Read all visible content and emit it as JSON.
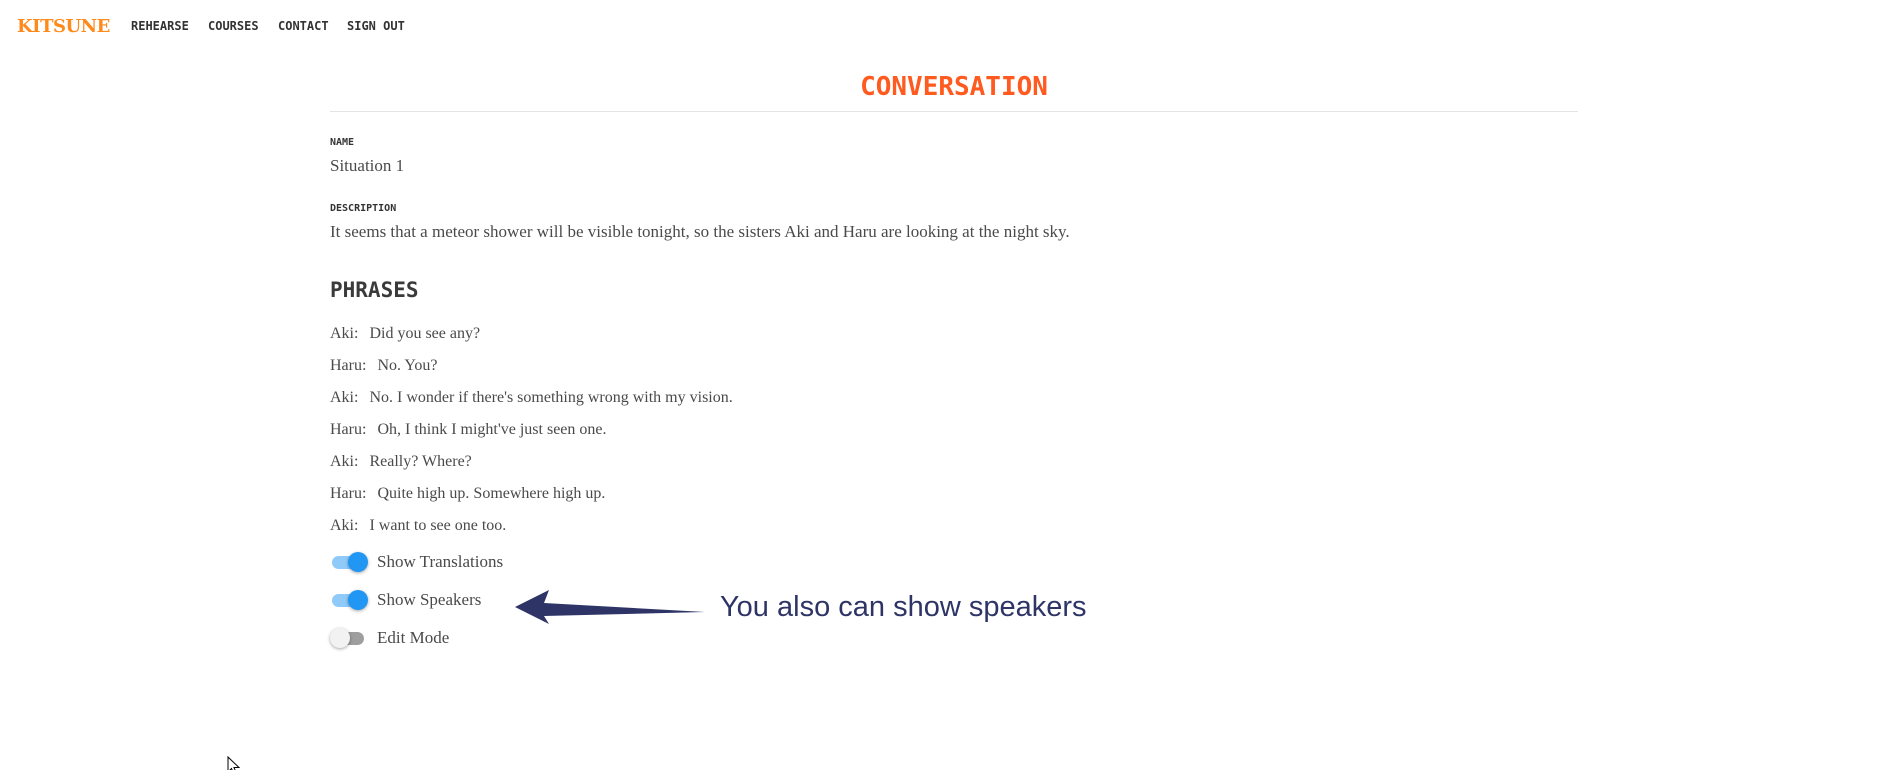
{
  "nav": {
    "logo": "KITSUNE",
    "links": [
      "REHEARSE",
      "COURSES",
      "CONTACT",
      "SIGN OUT"
    ]
  },
  "page": {
    "title": "CONVERSATION",
    "name_label": "NAME",
    "name_value": "Situation 1",
    "description_label": "DESCRIPTION",
    "description_value": "It seems that a meteor shower will be visible tonight, so the sisters Aki and Haru are looking at the night sky.",
    "phrases_heading": "PHRASES"
  },
  "phrases": [
    {
      "speaker": "Aki:",
      "text": "Did you see any?"
    },
    {
      "speaker": "Haru:",
      "text": "No. You?"
    },
    {
      "speaker": "Aki:",
      "text": "No. I wonder if there's something wrong with my vision."
    },
    {
      "speaker": "Haru:",
      "text": "Oh, I think I might've just seen one."
    },
    {
      "speaker": "Aki:",
      "text": "Really? Where?"
    },
    {
      "speaker": "Haru:",
      "text": "Quite high up. Somewhere high up."
    },
    {
      "speaker": "Aki:",
      "text": "I want to see one too."
    }
  ],
  "toggles": [
    {
      "label": "Show Translations",
      "on": true
    },
    {
      "label": "Show Speakers",
      "on": true
    },
    {
      "label": "Edit Mode",
      "on": false
    }
  ],
  "annotation": {
    "text": "You also can show speakers",
    "color": "#2e3566"
  },
  "colors": {
    "logo": "#ff8a1c",
    "title": "#ff5a1f",
    "toggle_on": "#2196f3",
    "toggle_track_on": "#90caf9",
    "toggle_off": "#9e9e9e"
  }
}
